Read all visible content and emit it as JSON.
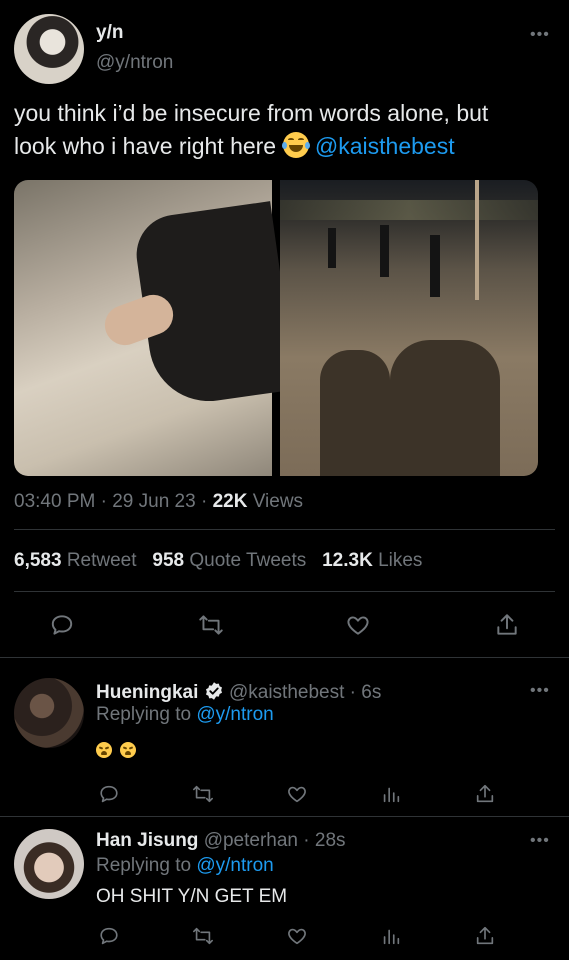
{
  "tweet": {
    "display_name": "y/n",
    "handle": "@y/ntron",
    "text_line1": "you think i’d be insecure from words alone, but",
    "text_line2": "look who i have right here",
    "mention": "@kaisthebest",
    "time": "03:40 PM",
    "date": "29 Jun 23",
    "views_count": "22K",
    "views_label": "Views",
    "retweets_count": "6,583",
    "retweets_label": "Retweet",
    "quotes_count": "958",
    "quotes_label": "Quote Tweets",
    "likes_count": "12.3K",
    "likes_label": "Likes",
    "sep": "·"
  },
  "replies": [
    {
      "display_name": "Hueningkai",
      "verified": true,
      "handle": "@kaisthebest",
      "time": "6s",
      "replying_to_label": "Replying to",
      "replying_to_handle": "@y/ntron",
      "text": ""
    },
    {
      "display_name": "Han Jisung",
      "verified": false,
      "handle": "@peterhan",
      "time": "28s",
      "replying_to_label": "Replying to",
      "replying_to_handle": "@y/ntron",
      "text": "OH SHIT Y/N GET EM"
    }
  ],
  "colors": {
    "background": "#000000",
    "text": "#e7e9ea",
    "muted": "#71767b",
    "link": "#1d9bf0",
    "divider": "#2f3336"
  },
  "icons": [
    "more-icon",
    "reply-icon",
    "retweet-icon",
    "like-icon",
    "share-icon",
    "views-icon",
    "verified-icon",
    "tired-face-emoji",
    "tears-of-joy-emoji"
  ]
}
